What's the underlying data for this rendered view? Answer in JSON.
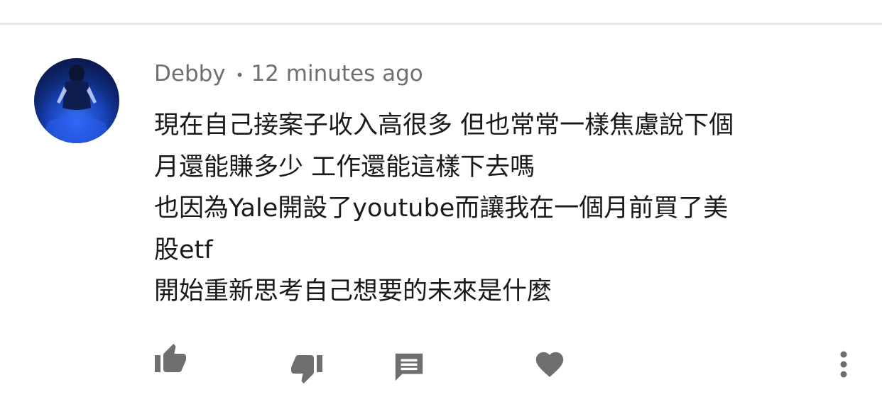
{
  "comment": {
    "author": "Debby",
    "separator": "•",
    "time": "12 minutes ago",
    "lines": [
      "現在自己接案子收入高很多 但也常常一樣焦慮說下個",
      "月還能賺多少 工作還能這樣下去嗎",
      "也因為Yale開設了youtube而讓我在一個月前買了美",
      "股etf",
      "開始重新思考自己想要的未來是什麼"
    ]
  },
  "actions": {
    "icons": [
      "thumb-up-icon",
      "thumb-down-icon",
      "reply-icon",
      "heart-icon",
      "more-vert-icon"
    ]
  },
  "colors": {
    "icon": "#6f6f6f",
    "meta_text": "#6f6f6f",
    "body_text": "#1a1a1a",
    "divider": "#e6e6e6",
    "avatar_blue": "#1d4fd6"
  }
}
